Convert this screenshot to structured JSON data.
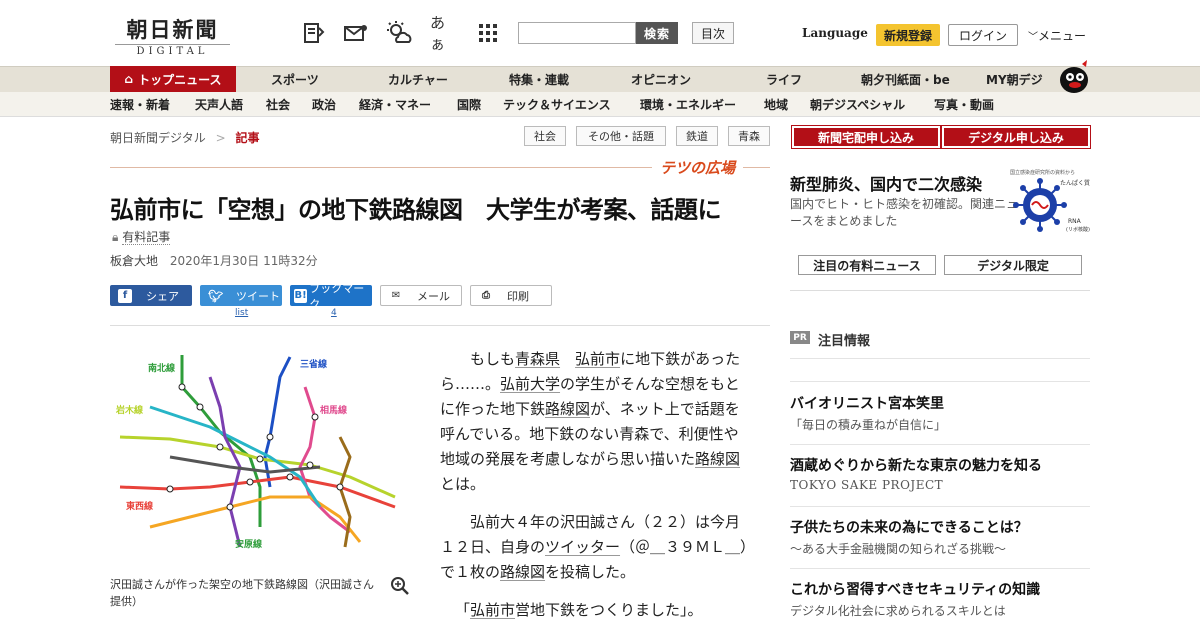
{
  "header": {
    "logo_jp": "朝日新聞",
    "logo_en": "DIGITAL",
    "icons": [
      "newspaper-icon",
      "mail-icon",
      "weather-icon",
      "font-size-icon",
      "grid-icon"
    ],
    "font_label": "あぁ",
    "search_button": "検索",
    "toc_button": "目次",
    "language": "Language",
    "signup": "新規登録",
    "login": "ログイン",
    "menu": "メニュー"
  },
  "nav_primary": [
    "トップニュース",
    "スポーツ",
    "カルチャー",
    "特集・連載",
    "オピニオン",
    "ライフ",
    "朝夕刊紙面・be",
    "MY朝デジ"
  ],
  "nav_secondary": [
    "速報・新着",
    "天声人語",
    "社会",
    "政治",
    "経済・マネー",
    "国際",
    "テック＆サイエンス",
    "環境・エネルギー",
    "地域",
    "朝デジスペシャル",
    "写真・動画"
  ],
  "breadcrumb": {
    "home": "朝日新聞デジタル",
    "sep": ">",
    "current": "記事"
  },
  "tags": [
    "社会",
    "その他・話題",
    "鉄道",
    "青森"
  ],
  "series": "テツの広場",
  "article": {
    "headline": "弘前市に「空想」の地下鉄路線図　大学生が考案、話題に",
    "paid_label": "有料記事",
    "author": "板倉大地",
    "date": "2020年1月30日 11時32分",
    "share": {
      "facebook": "シェア",
      "twitter": "ツイート",
      "hatena": "ブックマーク",
      "mail": "メール",
      "print": "印刷"
    },
    "share_counts": {
      "twitter": "list",
      "hatena": "4"
    },
    "photo_caption": "沢田誠さんが作った架空の地下鉄路線図（沢田誠さん提供）",
    "map_labels": [
      "南北線",
      "三省線",
      "岩木線",
      "相馬線",
      "東西線",
      "安原線"
    ],
    "body": {
      "p1": [
        "　もしも",
        "青森県",
        "弘前市",
        "に地下鉄があったら……。",
        "弘前大学",
        "の学生がそんな空想をもとに作った地下鉄",
        "路線図",
        "が、ネット上で話題を呼んでいる。地下鉄のない青森で、利便性や地域の発展を考慮しながら思い描いた",
        "路線図",
        "とは。"
      ],
      "p2": [
        "　弘前大４年の沢田誠さん（２２）は今月１２日、自身の",
        "ツイッター",
        "（＠＿３９ＭＬ＿）で１枚の",
        "路線図",
        "を投稿した。"
      ],
      "p3": [
        "「",
        "弘前市",
        "営地下鉄をつくりました」。"
      ]
    }
  },
  "sidebar": {
    "buttons": [
      "新聞宅配申し込み",
      "デジタル申し込み"
    ],
    "covid_title": "新型肺炎、国内で二次感染",
    "covid_text": "国内でヒト・ヒト感染を初確認。関連ニュースをまとめました",
    "covid_img_caption": "国立感染症研究所の資料から",
    "covid_img_labels": [
      "たんぱく質",
      "RNA",
      "(リボ核酸)"
    ],
    "links": [
      "注目の有料ニュース",
      "デジタル限定"
    ],
    "pr_badge": "PR",
    "pr_heading": "注目情報",
    "pr_items": [
      {
        "title": "バイオリニスト宮本笑里",
        "sub": "「毎日の積み重ねが自信に」"
      },
      {
        "title": "酒蔵めぐりから新たな東京の魅力を知る",
        "sub": "TOKYO SAKE PROJECT"
      },
      {
        "title": "子供たちの未来の為にできることは？",
        "sub": "～ある大手金融機関の知られざる挑戦～"
      },
      {
        "title": "これから習得すべきセキュリティの知識",
        "sub": "デジタル化社会に求められるスキルとは"
      }
    ]
  },
  "colors": {
    "brand_red": "#b30f17",
    "signup_yellow": "#f4c42f",
    "facebook": "#2d5a9e",
    "twitter": "#3a8fd6",
    "hatena": "#1e73c8"
  }
}
